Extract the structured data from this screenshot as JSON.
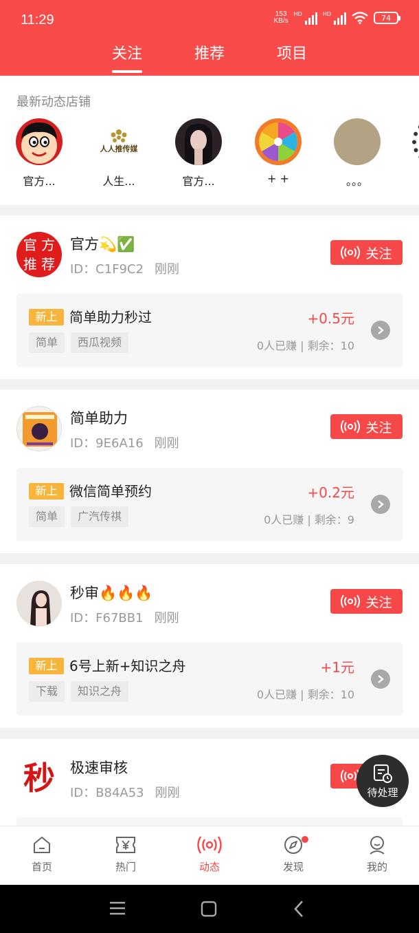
{
  "status_bar": {
    "time": "11:29",
    "net_speed_value": "153",
    "net_speed_unit": "KB/s",
    "hd_1": "HD",
    "hd_2": "HD",
    "battery": "74"
  },
  "top_tabs": [
    {
      "label": "关注",
      "active": true
    },
    {
      "label": "推荐",
      "active": false
    },
    {
      "label": "项目",
      "active": false
    }
  ],
  "stores": {
    "title": "最新动态店铺",
    "items": [
      {
        "name": "官方..."
      },
      {
        "name": "人生...",
        "logo_text": "人人推传媒"
      },
      {
        "name": "官方..."
      },
      {
        "name": "+ +"
      },
      {
        "name": "。。。"
      }
    ]
  },
  "cards": [
    {
      "avatar_text": [
        "官 方",
        "推 荐"
      ],
      "name": "官方💫✅",
      "id": "ID：C1F9C2",
      "time": "刚刚",
      "follow_label": "关注",
      "task": {
        "badge": "新上",
        "title": "简单助力秒过",
        "price": "+0.5元",
        "tags": [
          "简单",
          "西瓜视频"
        ],
        "meta": "0人已赚 | 剩余：10"
      }
    },
    {
      "name": "简单助力",
      "id": "ID：9E6A16",
      "time": "刚刚",
      "follow_label": "关注",
      "task": {
        "badge": "新上",
        "title": "微信简单预约",
        "price": "+0.2元",
        "tags": [
          "简单",
          "广汽传祺"
        ],
        "meta": "0人已赚 | 剩余：9"
      }
    },
    {
      "name": "秒审🔥🔥🔥",
      "id": "ID：F67BB1",
      "time": "刚刚",
      "follow_label": "关注",
      "task": {
        "badge": "新上",
        "title": "6号上新+知识之舟",
        "price": "+1元",
        "tags": [
          "下载",
          "知识之舟"
        ],
        "meta": "0人已赚 | 剩余：10"
      }
    },
    {
      "avatar_text": "秒",
      "name": "极速审核",
      "id": "ID：B84A53",
      "time": "刚刚",
      "follow_label": "关注"
    }
  ],
  "pending_button": {
    "label": "待处理"
  },
  "bottom_nav": [
    {
      "label": "首页",
      "icon": "home-icon"
    },
    {
      "label": "热门",
      "icon": "yen-ticket-icon"
    },
    {
      "label": "动态",
      "icon": "broadcast-icon",
      "active": true
    },
    {
      "label": "发现",
      "icon": "compass-icon",
      "has_dot": true
    },
    {
      "label": "我的",
      "icon": "user-icon"
    }
  ],
  "colors": {
    "brand_red": "#fa4b4b",
    "button_red": "#f64848",
    "badge_orange": "#f7b63b"
  }
}
